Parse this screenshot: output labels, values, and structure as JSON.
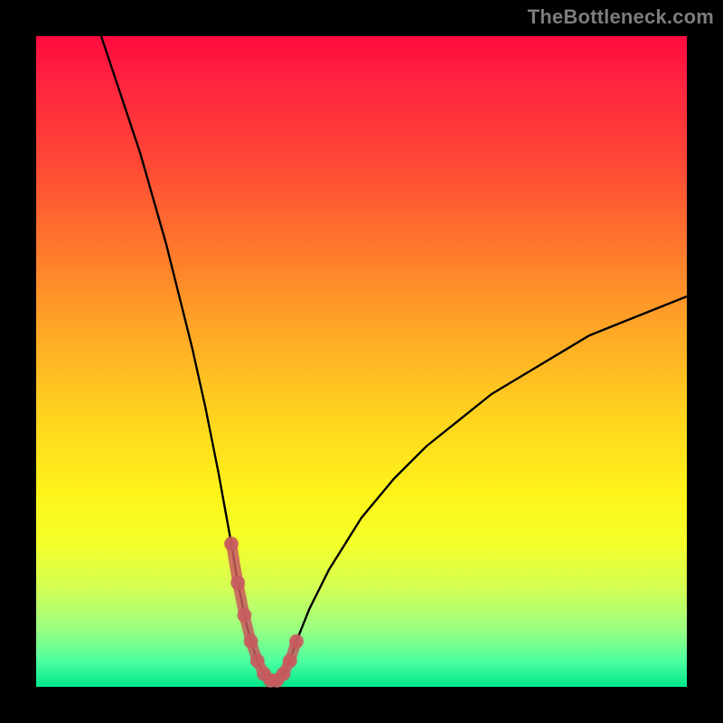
{
  "watermark": "TheBottleneck.com",
  "colors": {
    "background": "#000000",
    "curve": "#000000",
    "marker": "#c85a5f",
    "good": "#00e88a",
    "bad": "#ff0b3e"
  },
  "chart_data": {
    "type": "line",
    "title": "",
    "xlabel": "",
    "ylabel": "",
    "xlim": [
      0,
      100
    ],
    "ylim": [
      0,
      100
    ],
    "grid": false,
    "legend": false,
    "series": [
      {
        "name": "bottleneck-curve",
        "x": [
          10,
          12,
          14,
          16,
          18,
          20,
          22,
          24,
          26,
          28,
          30,
          31,
          32,
          33,
          34,
          35,
          36,
          37,
          38,
          39,
          40,
          42,
          45,
          50,
          55,
          60,
          65,
          70,
          75,
          80,
          85,
          90,
          95,
          100
        ],
        "y": [
          100,
          94,
          88,
          82,
          75,
          68,
          60,
          52,
          43,
          33,
          22,
          16,
          11,
          7,
          4,
          2,
          1,
          1,
          2,
          4,
          7,
          12,
          18,
          26,
          32,
          37,
          41,
          45,
          48,
          51,
          54,
          56,
          58,
          60
        ]
      }
    ],
    "markers": {
      "name": "highlighted-range",
      "x_range": [
        30,
        40
      ],
      "points_x": [
        30,
        31,
        32,
        33,
        34,
        35,
        36,
        37,
        38,
        39,
        40
      ],
      "points_y": [
        22,
        16,
        11,
        7,
        4,
        2,
        1,
        1,
        2,
        4,
        7
      ]
    },
    "note": "No numeric axis ticks are visible; values are estimated from plot geometry on a 0–100 scale."
  }
}
